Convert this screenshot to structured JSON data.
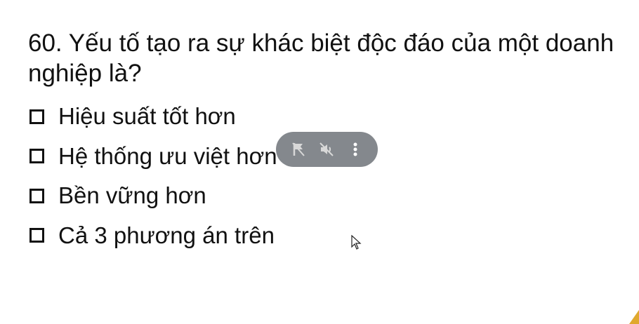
{
  "question": {
    "text": "60. Yếu tố tạo ra sự khác biệt độc đáo của một doanh nghiệp là?"
  },
  "options": [
    {
      "label": "Hiệu suất tốt hơn",
      "checked": false
    },
    {
      "label": "Hệ thống ưu việt hơn",
      "checked": false
    },
    {
      "label": "Bền vững hơn",
      "checked": false
    },
    {
      "label": "Cả 3 phương án trên",
      "checked": false
    }
  ],
  "media_controls": {
    "icons": [
      "flag-icon",
      "mute-icon",
      "more-vertical-icon"
    ]
  },
  "colors": {
    "text": "#111111",
    "background": "#ffffff",
    "pill": "#70757a",
    "accent_corner": "#e0a82e"
  }
}
